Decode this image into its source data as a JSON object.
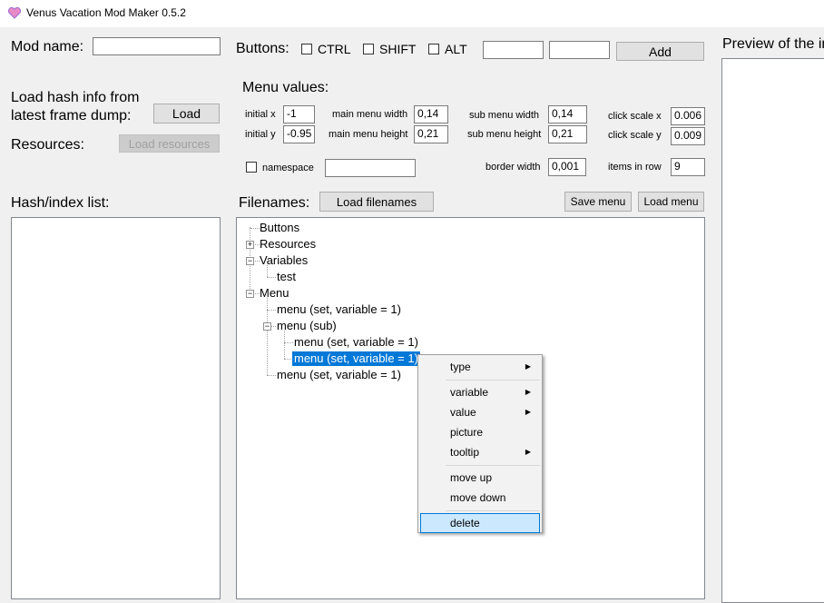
{
  "window": {
    "title": "Venus Vacation Mod Maker 0.5.2"
  },
  "mod_name": {
    "label": "Mod name:",
    "value": ""
  },
  "buttons_row": {
    "label": "Buttons:",
    "ctrl": "CTRL",
    "shift": "SHIFT",
    "alt": "ALT",
    "key_field_1": "",
    "key_field_2": "",
    "add": "Add"
  },
  "load_hash": {
    "label_line1": "Load hash info from",
    "label_line2": "latest frame dump:",
    "button": "Load"
  },
  "resources": {
    "label": "Resources:",
    "button": "Load resources"
  },
  "menu_values": {
    "title": "Menu values:",
    "initial_x_label": "initial x",
    "initial_x": "-1",
    "initial_y_label": "initial y",
    "initial_y": "-0.95",
    "main_width_label": "main menu width",
    "main_width": "0,14",
    "main_height_label": "main menu height",
    "main_height": "0,21",
    "sub_width_label": "sub menu width",
    "sub_width": "0,14",
    "sub_height_label": "sub menu height",
    "sub_height": "0,21",
    "click_x_label": "click scale x",
    "click_x": "0.006",
    "click_y_label": "click scale y",
    "click_y": "0.009",
    "namespace_label": "namespace",
    "namespace": "",
    "border_width_label": "border width",
    "border_width": "0,001",
    "items_row_label": "items in row",
    "items_row": "9"
  },
  "hash_list": {
    "label": "Hash/index list:"
  },
  "filenames": {
    "label": "Filenames:",
    "load_button": "Load filenames",
    "save_menu": "Save menu",
    "load_menu": "Load menu"
  },
  "tree": {
    "buttons": "Buttons",
    "resources": "Resources",
    "variables": "Variables",
    "test": "test",
    "menu": "Menu",
    "menu_item_1": "menu (set, variable = 1)",
    "menu_sub": "menu (sub)",
    "sub_item_1": "menu (set, variable = 1)",
    "sub_item_2": "menu (set, variable = 1)",
    "menu_item_2": "menu (set, variable = 1)"
  },
  "context_menu": {
    "type": "type",
    "variable": "variable",
    "value": "value",
    "picture": "picture",
    "tooltip": "tooltip",
    "move_up": "move up",
    "move_down": "move down",
    "delete": "delete"
  },
  "preview": {
    "label": "Preview of the in"
  },
  "colors": {
    "selection": "#0078d7",
    "hover": "#cce8ff"
  }
}
